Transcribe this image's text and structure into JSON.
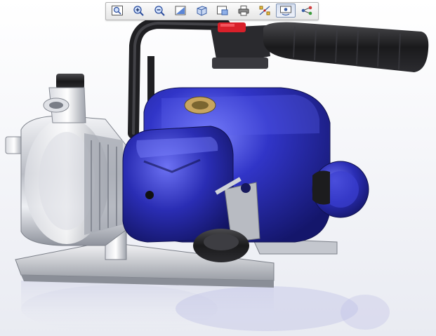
{
  "viewer": {
    "toolbar": {
      "buttons": [
        {
          "id": "zoom-window",
          "icon": "zoom-window-icon",
          "active": false
        },
        {
          "id": "zoom-in",
          "icon": "zoom-in-icon",
          "active": false
        },
        {
          "id": "zoom-out",
          "icon": "zoom-out-icon",
          "active": false
        },
        {
          "id": "shaded",
          "icon": "shaded-view-icon",
          "active": false
        },
        {
          "id": "view-orientation",
          "icon": "view-cube-icon",
          "active": false
        },
        {
          "id": "saved-views",
          "icon": "saved-views-icon",
          "active": false
        },
        {
          "id": "print",
          "icon": "print-icon",
          "active": false
        },
        {
          "id": "explode",
          "icon": "explode-icon",
          "active": false
        },
        {
          "id": "orient",
          "icon": "orient-icon",
          "active": true
        },
        {
          "id": "tree",
          "icon": "model-tree-icon",
          "active": false
        }
      ]
    },
    "model": {
      "colors": {
        "engine_blue": "#2c2fb8",
        "aluminum": "#c9ccd3",
        "handle_black": "#1c1c1e",
        "accent_red": "#d8202a"
      }
    }
  }
}
